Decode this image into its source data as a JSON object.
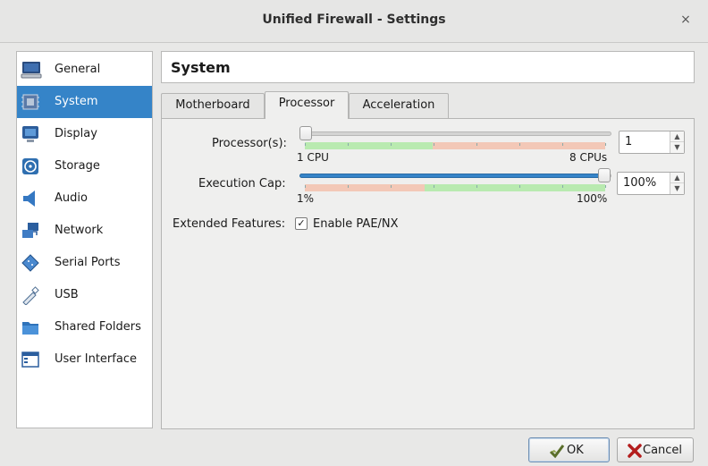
{
  "window": {
    "title": "Unified Firewall - Settings",
    "close_glyph": "×"
  },
  "sidebar": {
    "items": [
      {
        "label": "General",
        "icon": "general-icon",
        "selected": false
      },
      {
        "label": "System",
        "icon": "system-icon",
        "selected": true
      },
      {
        "label": "Display",
        "icon": "display-icon",
        "selected": false
      },
      {
        "label": "Storage",
        "icon": "storage-icon",
        "selected": false
      },
      {
        "label": "Audio",
        "icon": "audio-icon",
        "selected": false
      },
      {
        "label": "Network",
        "icon": "network-icon",
        "selected": false
      },
      {
        "label": "Serial Ports",
        "icon": "serial-ports-icon",
        "selected": false
      },
      {
        "label": "USB",
        "icon": "usb-icon",
        "selected": false
      },
      {
        "label": "Shared Folders",
        "icon": "shared-folders-icon",
        "selected": false
      },
      {
        "label": "User Interface",
        "icon": "user-interface-icon",
        "selected": false
      }
    ]
  },
  "header": {
    "title": "System"
  },
  "tabs": [
    {
      "label": "Motherboard",
      "active": false
    },
    {
      "label": "Processor",
      "active": true
    },
    {
      "label": "Acceleration",
      "active": false
    }
  ],
  "processor": {
    "processors_label": "Processor(s):",
    "processors_value": "1",
    "processors_min_label": "1 CPU",
    "processors_max_label": "8 CPUs",
    "processors_level": 0.0,
    "exec_cap_label": "Execution Cap:",
    "exec_cap_value": "100%",
    "exec_cap_min_label": "1%",
    "exec_cap_max_label": "100%",
    "exec_cap_level": 1.0,
    "extended_label": "Extended Features:",
    "pae_label": "Enable PAE/NX",
    "pae_checked": true,
    "check_glyph": "✓"
  },
  "buttons": {
    "ok_label": "OK",
    "cancel_label": "Cancel"
  },
  "colors": {
    "accent": "#3584c8",
    "safe_band": "#b9eab0",
    "warn_band": "#f3c8b7"
  }
}
